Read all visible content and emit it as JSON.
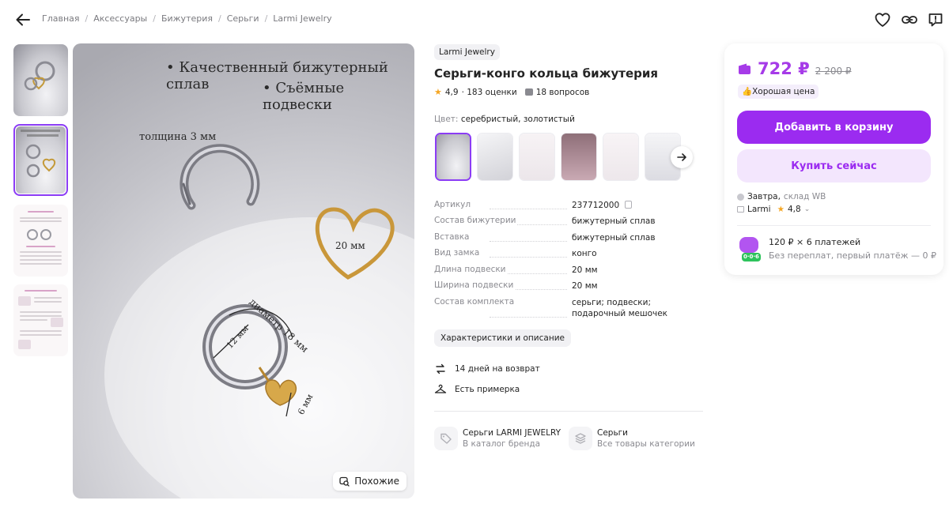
{
  "breadcrumbs": [
    "Главная",
    "Аксессуары",
    "Бижутерия",
    "Серьги",
    "Larmi Jewelry"
  ],
  "main_image": {
    "bullet1": "• Качественный бижутерный сплав",
    "bullet2": "• Съёмные подвески",
    "thickness": "толщина 3 мм",
    "heart_size": "20 мм",
    "diameter": "диаметр 18 мм",
    "inner": "12 мм",
    "pendant": "6 мм",
    "similar_label": "Похожие"
  },
  "product": {
    "brand": "Larmi Jewelry",
    "title": "Серьги-конго кольца бижутерия",
    "rating": "4,9",
    "reviews": "· 183 оценки",
    "questions": "18 вопросов",
    "color_key": "Цвет:",
    "color_value": "серебристый, золотистый",
    "specs": [
      {
        "k": "Артикул",
        "v": "237712000"
      },
      {
        "k": "Состав бижутерии",
        "v": "бижутерный сплав"
      },
      {
        "k": "Вставка",
        "v": "бижутерный сплав"
      },
      {
        "k": "Вид замка",
        "v": "конго"
      },
      {
        "k": "Длина подвески",
        "v": "20 мм"
      },
      {
        "k": "Ширина подвески",
        "v": "20 мм"
      },
      {
        "k": "Состав комплекта",
        "v": "серьги; подвески; подарочный мешочек"
      }
    ],
    "characteristics_button": "Характеристики и описание",
    "features": [
      "14 дней на возврат",
      "Есть примерка"
    ],
    "brand_link": {
      "title": "Серьги LARMI JEWELRY",
      "sub": "В каталог бренда"
    },
    "category_link": {
      "title": "Серьги",
      "sub": "Все товары категории"
    }
  },
  "card": {
    "price": "722 ₽",
    "old_price": "2 200 ₽",
    "good_price": "Хорошая цена",
    "add_to_cart": "Добавить в корзину",
    "buy_now": "Купить сейчас",
    "delivery": "Завтра,",
    "warehouse": "склад WB",
    "seller": "Larmi",
    "seller_rating": "4,8",
    "installment_title": "120 ₽ × 6 платежей",
    "installment_sub": "Без переплат, первый платёж — 0 ₽",
    "installment_badge": "0·0·6"
  },
  "colors": {
    "accent": "#9b2bf0",
    "price": "#a63be8",
    "star": "#f5a623"
  }
}
